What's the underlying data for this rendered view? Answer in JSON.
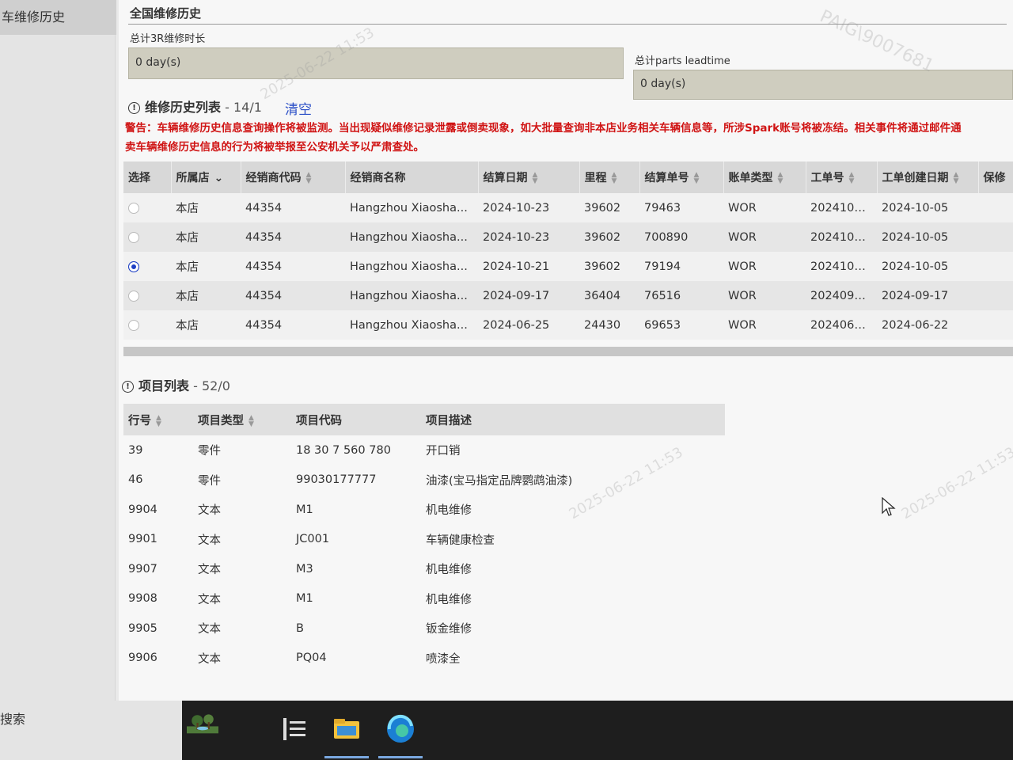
{
  "sidebar": {
    "title": "车维修历史",
    "search_label": "搜索"
  },
  "page": {
    "title": "全国维修历史",
    "total_3r_label": "总计3R维修时长",
    "total_3r_value": "0 day(s)",
    "parts_leadtime_label": "总计parts leadtime",
    "parts_leadtime_value": "0 day(s)"
  },
  "history": {
    "title": "维修历史列表",
    "count": " - 14/1",
    "clear_label": "清空",
    "warning_line1": "警告：车辆维修历史信息查询操作将被监测。当出现疑似维修记录泄露或倒卖现象，如大批量查询非本店业务相关车辆信息等，所涉Spark账号将被冻结。相关事件将通过邮件通",
    "warning_line2": "卖车辆维修历史信息的行为将被举报至公安机关予以严肃查处。",
    "columns": [
      "选择",
      "所属店",
      "经销商代码",
      "经销商名称",
      "结算日期",
      "里程",
      "结算单号",
      "账单类型",
      "工单号",
      "工单创建日期",
      "保修"
    ],
    "rows": [
      {
        "store": "本店",
        "code": "44354",
        "name": "Hangzhou Xiaosha...",
        "date": "2024-10-23",
        "mileage": "39602",
        "invoice": "79463",
        "type": "WOR",
        "order": "2024100...",
        "created": "2024-10-05",
        "selected": false
      },
      {
        "store": "本店",
        "code": "44354",
        "name": "Hangzhou Xiaosha...",
        "date": "2024-10-23",
        "mileage": "39602",
        "invoice": "700890",
        "type": "WOR",
        "order": "2024100...",
        "created": "2024-10-05",
        "selected": false
      },
      {
        "store": "本店",
        "code": "44354",
        "name": "Hangzhou Xiaosha...",
        "date": "2024-10-21",
        "mileage": "39602",
        "invoice": "79194",
        "type": "WOR",
        "order": "2024100...",
        "created": "2024-10-05",
        "selected": true
      },
      {
        "store": "本店",
        "code": "44354",
        "name": "Hangzhou Xiaosha...",
        "date": "2024-09-17",
        "mileage": "36404",
        "invoice": "76516",
        "type": "WOR",
        "order": "2024091...",
        "created": "2024-09-17",
        "selected": false
      },
      {
        "store": "本店",
        "code": "44354",
        "name": "Hangzhou Xiaosha...",
        "date": "2024-06-25",
        "mileage": "24430",
        "invoice": "69653",
        "type": "WOR",
        "order": "2024062...",
        "created": "2024-06-22",
        "selected": false
      }
    ]
  },
  "items": {
    "title": "项目列表",
    "count": " - 52/0",
    "columns": [
      "行号",
      "项目类型",
      "项目代码",
      "项目描述"
    ],
    "rows": [
      {
        "line": "39",
        "type": "零件",
        "code": "18 30 7 560 780",
        "desc": "开口销"
      },
      {
        "line": "46",
        "type": "零件",
        "code": "99030177777",
        "desc": "油漆(宝马指定品牌鹦鹉油漆)"
      },
      {
        "line": "9904",
        "type": "文本",
        "code": "M1",
        "desc": "机电维修"
      },
      {
        "line": "9901",
        "type": "文本",
        "code": "JC001",
        "desc": "车辆健康检查"
      },
      {
        "line": "9907",
        "type": "文本",
        "code": "M3",
        "desc": "机电维修"
      },
      {
        "line": "9908",
        "type": "文本",
        "code": "M1",
        "desc": "机电维修"
      },
      {
        "line": "9905",
        "type": "文本",
        "code": "B",
        "desc": "钣金维修"
      },
      {
        "line": "9906",
        "type": "文本",
        "code": "PQ04",
        "desc": "喷漆全"
      }
    ]
  },
  "watermark": {
    "user": "PAIG\\9007681",
    "time": "2025-06-22 11:53"
  },
  "colors": {
    "warning": "#d01414",
    "link": "#2b4fc7",
    "radio_selected": "#1d3fc4"
  }
}
